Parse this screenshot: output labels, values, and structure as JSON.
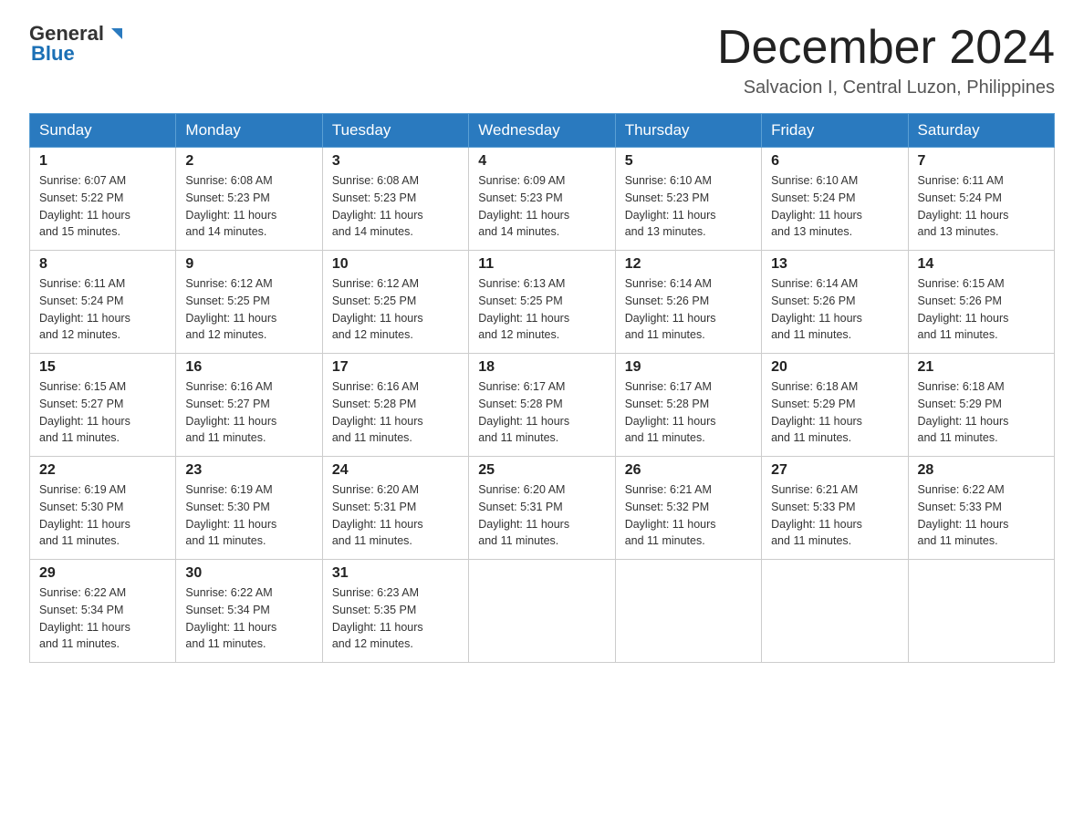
{
  "header": {
    "logo_general": "General",
    "logo_blue": "Blue",
    "month_title": "December 2024",
    "location": "Salvacion I, Central Luzon, Philippines"
  },
  "days_of_week": [
    "Sunday",
    "Monday",
    "Tuesday",
    "Wednesday",
    "Thursday",
    "Friday",
    "Saturday"
  ],
  "weeks": [
    [
      {
        "day": "1",
        "sunrise": "6:07 AM",
        "sunset": "5:22 PM",
        "daylight": "11 hours and 15 minutes."
      },
      {
        "day": "2",
        "sunrise": "6:08 AM",
        "sunset": "5:23 PM",
        "daylight": "11 hours and 14 minutes."
      },
      {
        "day": "3",
        "sunrise": "6:08 AM",
        "sunset": "5:23 PM",
        "daylight": "11 hours and 14 minutes."
      },
      {
        "day": "4",
        "sunrise": "6:09 AM",
        "sunset": "5:23 PM",
        "daylight": "11 hours and 14 minutes."
      },
      {
        "day": "5",
        "sunrise": "6:10 AM",
        "sunset": "5:23 PM",
        "daylight": "11 hours and 13 minutes."
      },
      {
        "day": "6",
        "sunrise": "6:10 AM",
        "sunset": "5:24 PM",
        "daylight": "11 hours and 13 minutes."
      },
      {
        "day": "7",
        "sunrise": "6:11 AM",
        "sunset": "5:24 PM",
        "daylight": "11 hours and 13 minutes."
      }
    ],
    [
      {
        "day": "8",
        "sunrise": "6:11 AM",
        "sunset": "5:24 PM",
        "daylight": "11 hours and 12 minutes."
      },
      {
        "day": "9",
        "sunrise": "6:12 AM",
        "sunset": "5:25 PM",
        "daylight": "11 hours and 12 minutes."
      },
      {
        "day": "10",
        "sunrise": "6:12 AM",
        "sunset": "5:25 PM",
        "daylight": "11 hours and 12 minutes."
      },
      {
        "day": "11",
        "sunrise": "6:13 AM",
        "sunset": "5:25 PM",
        "daylight": "11 hours and 12 minutes."
      },
      {
        "day": "12",
        "sunrise": "6:14 AM",
        "sunset": "5:26 PM",
        "daylight": "11 hours and 11 minutes."
      },
      {
        "day": "13",
        "sunrise": "6:14 AM",
        "sunset": "5:26 PM",
        "daylight": "11 hours and 11 minutes."
      },
      {
        "day": "14",
        "sunrise": "6:15 AM",
        "sunset": "5:26 PM",
        "daylight": "11 hours and 11 minutes."
      }
    ],
    [
      {
        "day": "15",
        "sunrise": "6:15 AM",
        "sunset": "5:27 PM",
        "daylight": "11 hours and 11 minutes."
      },
      {
        "day": "16",
        "sunrise": "6:16 AM",
        "sunset": "5:27 PM",
        "daylight": "11 hours and 11 minutes."
      },
      {
        "day": "17",
        "sunrise": "6:16 AM",
        "sunset": "5:28 PM",
        "daylight": "11 hours and 11 minutes."
      },
      {
        "day": "18",
        "sunrise": "6:17 AM",
        "sunset": "5:28 PM",
        "daylight": "11 hours and 11 minutes."
      },
      {
        "day": "19",
        "sunrise": "6:17 AM",
        "sunset": "5:28 PM",
        "daylight": "11 hours and 11 minutes."
      },
      {
        "day": "20",
        "sunrise": "6:18 AM",
        "sunset": "5:29 PM",
        "daylight": "11 hours and 11 minutes."
      },
      {
        "day": "21",
        "sunrise": "6:18 AM",
        "sunset": "5:29 PM",
        "daylight": "11 hours and 11 minutes."
      }
    ],
    [
      {
        "day": "22",
        "sunrise": "6:19 AM",
        "sunset": "5:30 PM",
        "daylight": "11 hours and 11 minutes."
      },
      {
        "day": "23",
        "sunrise": "6:19 AM",
        "sunset": "5:30 PM",
        "daylight": "11 hours and 11 minutes."
      },
      {
        "day": "24",
        "sunrise": "6:20 AM",
        "sunset": "5:31 PM",
        "daylight": "11 hours and 11 minutes."
      },
      {
        "day": "25",
        "sunrise": "6:20 AM",
        "sunset": "5:31 PM",
        "daylight": "11 hours and 11 minutes."
      },
      {
        "day": "26",
        "sunrise": "6:21 AM",
        "sunset": "5:32 PM",
        "daylight": "11 hours and 11 minutes."
      },
      {
        "day": "27",
        "sunrise": "6:21 AM",
        "sunset": "5:33 PM",
        "daylight": "11 hours and 11 minutes."
      },
      {
        "day": "28",
        "sunrise": "6:22 AM",
        "sunset": "5:33 PM",
        "daylight": "11 hours and 11 minutes."
      }
    ],
    [
      {
        "day": "29",
        "sunrise": "6:22 AM",
        "sunset": "5:34 PM",
        "daylight": "11 hours and 11 minutes."
      },
      {
        "day": "30",
        "sunrise": "6:22 AM",
        "sunset": "5:34 PM",
        "daylight": "11 hours and 11 minutes."
      },
      {
        "day": "31",
        "sunrise": "6:23 AM",
        "sunset": "5:35 PM",
        "daylight": "11 hours and 12 minutes."
      },
      null,
      null,
      null,
      null
    ]
  ],
  "labels": {
    "sunrise": "Sunrise:",
    "sunset": "Sunset:",
    "daylight": "Daylight:"
  }
}
